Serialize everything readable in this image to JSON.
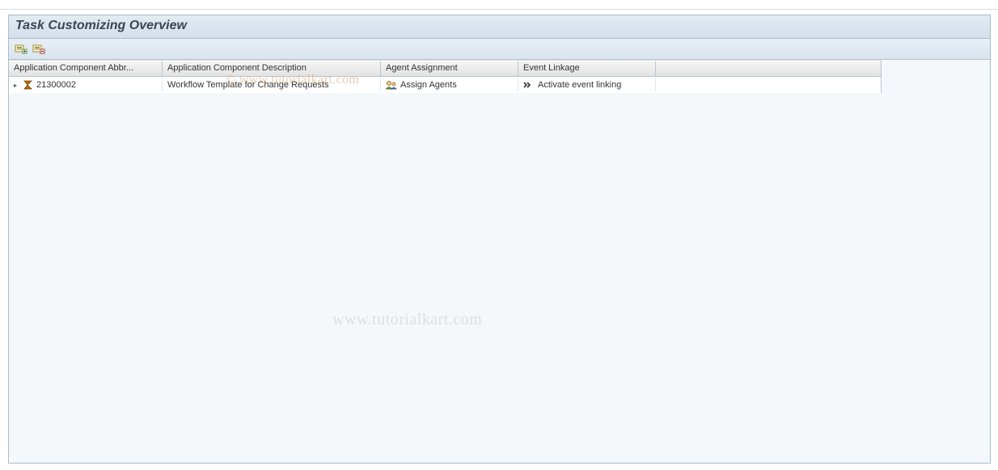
{
  "panel": {
    "title": "Task Customizing Overview"
  },
  "toolbar": {
    "expand_label": "expand-subtree",
    "collapse_label": "collapse-subtree"
  },
  "grid": {
    "columns": {
      "col1": "Application Component Abbr...",
      "col2": "Application Component Description",
      "col3": "Agent Assignment",
      "col4": "Event Linkage"
    },
    "rows": [
      {
        "abbr": "21300002",
        "desc": "Workflow Template for Change Requests",
        "agent": "Assign Agents",
        "event": "Activate event linking"
      }
    ]
  },
  "watermarks": {
    "top": "© www.tutorialkart.com",
    "mid": "www.tutorialkart.com"
  }
}
